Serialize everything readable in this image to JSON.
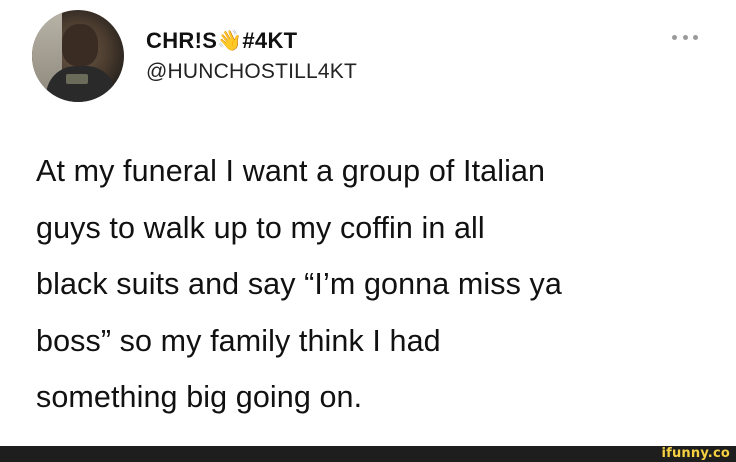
{
  "tweet": {
    "display_name": "CHR!S",
    "name_suffix": "#4KT",
    "wave_icon": "👋",
    "handle": "@HUNCHOSTILL4KT",
    "text": "At my funeral I want a group of Italian\nguys to walk up to my coffin in all\nblack suits and say “I’m gonna miss ya\nboss” so my family think I had\nsomething big going on."
  },
  "footer": {
    "watermark": "ifunny.co"
  }
}
